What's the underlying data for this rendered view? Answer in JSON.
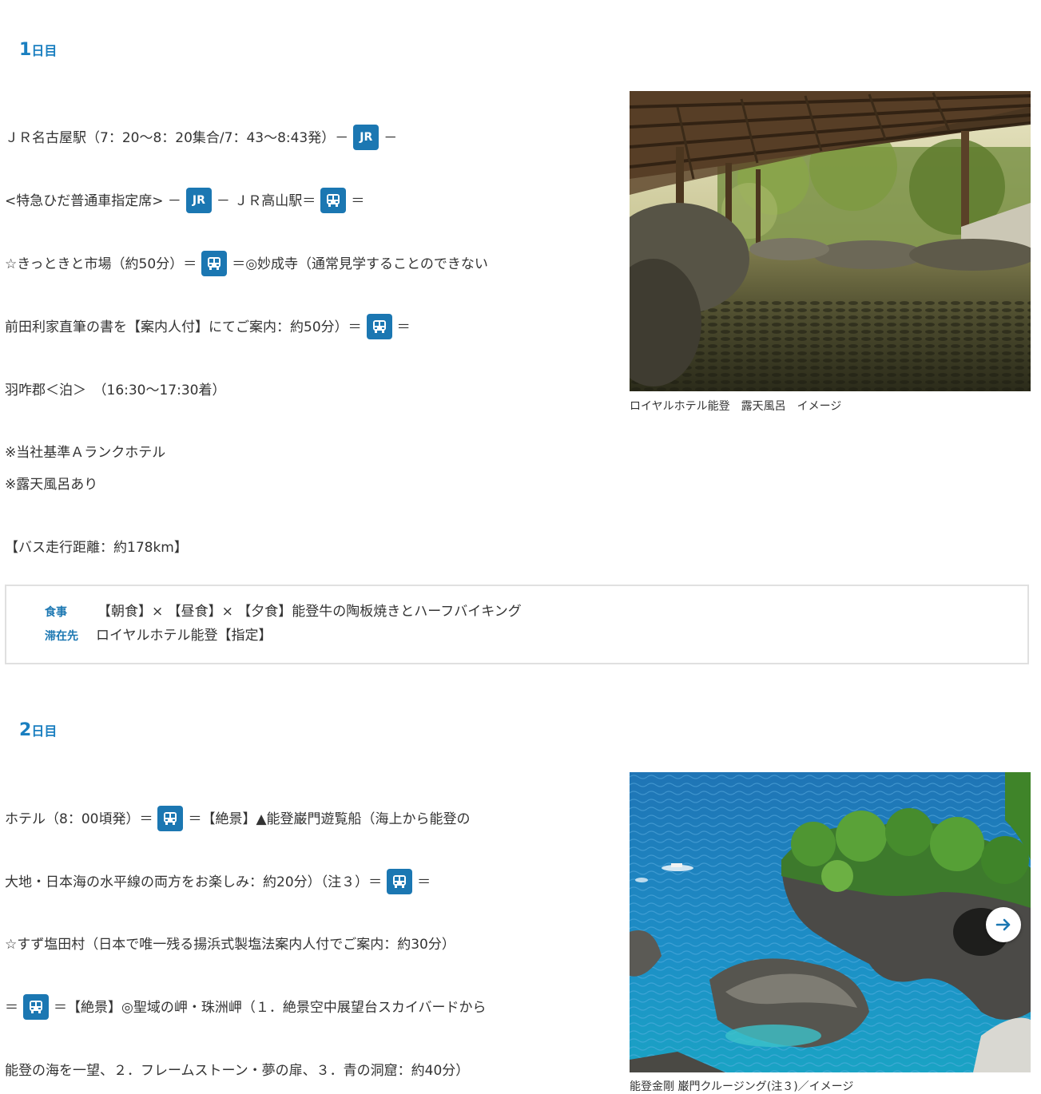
{
  "day1": {
    "num": "1",
    "suffix": "日目",
    "lines": [
      {
        "t1": "ＪＲ名古屋駅（7：20～8：20集合/7：43～8:43発）－",
        "tag": "JR",
        "t2": "－"
      },
      {
        "t1": "<特急ひだ普通車指定席> －",
        "tag": "JR",
        "t2": "－ ＪＲ高山駅＝",
        "tag2": "bus",
        "t3": "＝"
      },
      {
        "t1": "☆きっときと市場（約50分）＝",
        "tag": "bus",
        "t2": "＝◎妙成寺（通常見学することのできない"
      },
      {
        "t1": "前田利家直筆の書を【案内人付】にてご案内：約50分）＝",
        "tag": "bus",
        "t2": "＝"
      },
      {
        "t1": "羽咋郡＜泊＞　（16:30～17:30着）"
      }
    ],
    "notes": [
      "※当社基準Ａランクホテル",
      "※露天風呂あり"
    ],
    "distance": "【バス走行距離：約178km】",
    "meals_label": "食事",
    "meals_value": "【朝食】× 【昼食】× 【夕食】能登牛の陶板焼きとハーフバイキング",
    "stay_label": "滞在先",
    "stay_value": "ロイヤルホテル能登【指定】",
    "photo_caption": "ロイヤルホテル能登　露天風呂　イメージ"
  },
  "day2": {
    "num": "2",
    "suffix": "日目",
    "lines": [
      {
        "t1": "ホテル（8：00頃発）＝",
        "tag": "bus",
        "t2": "＝【絶景】▲能登巌門遊覧船（海上から能登の"
      },
      {
        "t1": "大地・日本海の水平線の両方をお楽しみ：約20分）（注３）＝",
        "tag": "bus",
        "t2": "＝"
      },
      {
        "t1": "☆すず塩田村（日本で唯一残る揚浜式製塩法案内人付でご案内：約30分）"
      },
      {
        "t1": "＝",
        "tag": "bus",
        "t2": "＝【絶景】◎聖域の岬・珠洲岬（１．絶景空中展望台スカイバードから"
      },
      {
        "t1": "能登の海を一望、２．フレームストーン・夢の扉、３．青の洞窟：約40分）"
      }
    ],
    "photo_caption": "能登金剛 巌門クルージング(注３)／イメージ"
  },
  "icons": {
    "jr": "JR",
    "bus": "bus-icon",
    "next": "arrow-right-icon"
  },
  "colors": {
    "accent": "#1a7fc0",
    "tag_bg": "#1b77b2",
    "box_border": "#e0e0e0"
  }
}
